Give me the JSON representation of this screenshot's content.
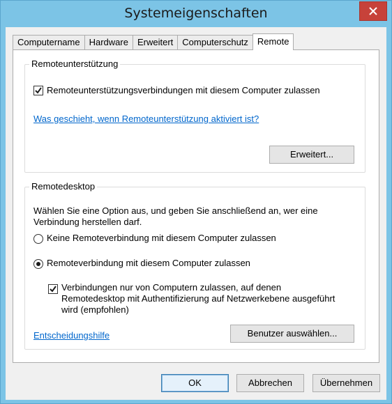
{
  "window": {
    "title": "Systemeigenschaften",
    "close_icon": "close-icon"
  },
  "tabs": [
    {
      "label": "Computername",
      "active": false
    },
    {
      "label": "Hardware",
      "active": false
    },
    {
      "label": "Erweitert",
      "active": false
    },
    {
      "label": "Computerschutz",
      "active": false
    },
    {
      "label": "Remote",
      "active": true
    }
  ],
  "remote_assistance": {
    "group_title": "Remoteunterstützung",
    "allow_checkbox": {
      "label": "Remoteunterstützungsverbindungen mit diesem Computer zulassen",
      "checked": true
    },
    "help_link": "Was geschieht, wenn Remoteunterstützung aktiviert ist?",
    "advanced_button": "Erweitert..."
  },
  "remote_desktop": {
    "group_title": "Remotedesktop",
    "description_line1": "Wählen Sie eine Option aus, und geben Sie anschließend an, wer eine",
    "description_line2": "Verbindung herstellen darf.",
    "option_none": {
      "label": "Keine Remoteverbindung mit diesem Computer zulassen",
      "selected": false
    },
    "option_allow": {
      "label": "Remoteverbindung mit diesem Computer zulassen",
      "selected": true
    },
    "nla_checkbox": {
      "line1": "Verbindungen nur von Computern zulassen, auf denen",
      "line2": "Remotedesktop mit Authentifizierung auf Netzwerkebene ausgeführt",
      "line3": "wird (empfohlen)",
      "checked": true
    },
    "help_link": "Entscheidungshilfe",
    "select_users_button": "Benutzer auswählen..."
  },
  "footer": {
    "ok": "OK",
    "cancel": "Abbrechen",
    "apply": "Übernehmen"
  }
}
